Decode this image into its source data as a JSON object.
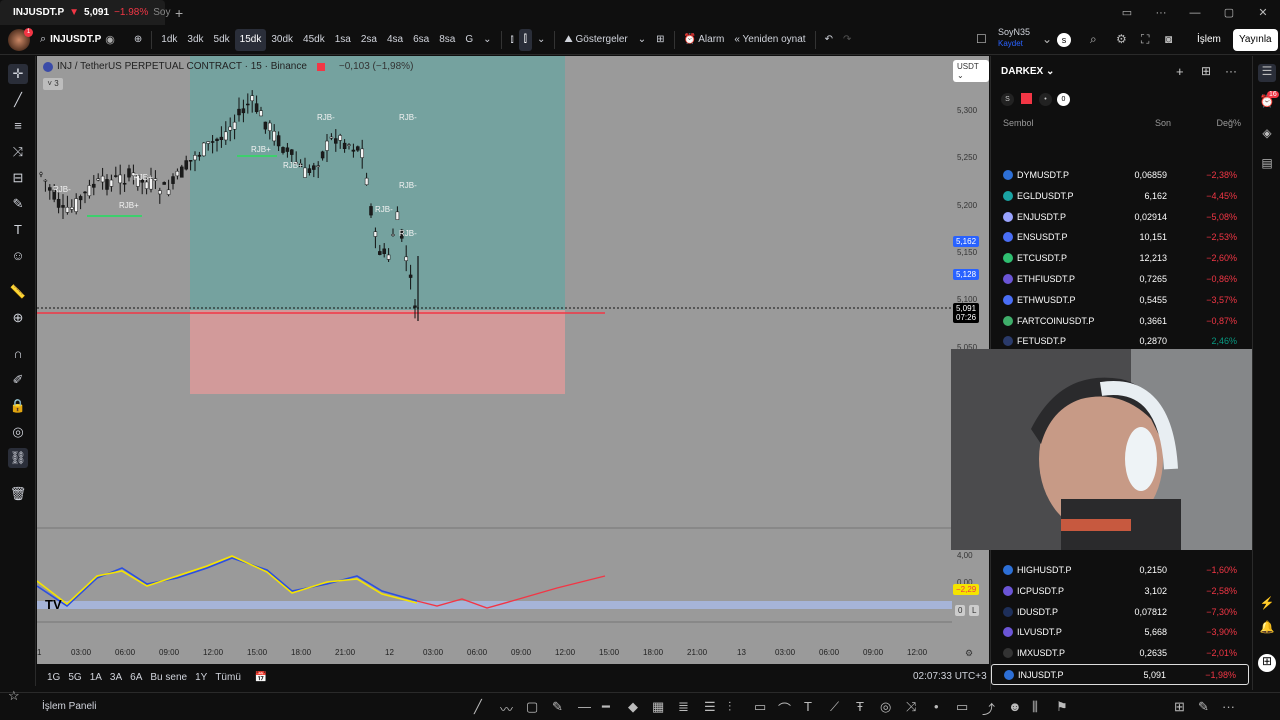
{
  "tab": {
    "symbol": "INJUSDT.P",
    "arrow": "▼",
    "price": "5,091",
    "change": "−1.98%",
    "rest": "Soy"
  },
  "toolbar": {
    "symbol": "INJUSDT.P",
    "intervals": [
      "1dk",
      "3dk",
      "5dk",
      "15dk",
      "30dk",
      "45dk",
      "1sa",
      "2sa",
      "4sa",
      "6sa",
      "8sa",
      "G"
    ],
    "active_interval": "15dk",
    "indicators_label": "Göstergeler",
    "alarm_label": "Alarm",
    "replay_label": "Yeniden oynat",
    "user_name": "SoyN35",
    "user_saved": "Kaydet",
    "trade_label": "İşlem",
    "publish_label": "Yayınla"
  },
  "chart": {
    "legend": "INJ / TetherUS PERPETUAL CONTRACT · 15 · Binance",
    "legend_change": "−0,103 (−1,98%)",
    "collapse_label": "3",
    "currency": "USDT",
    "price_ticks": [
      "5,300",
      "5,250",
      "5,200",
      "5,150",
      "5,100",
      "5,050"
    ],
    "tag_a": "5,162",
    "tag_b": "5,128",
    "last_price": "5,091",
    "countdown": "07:26",
    "labels": [
      "RJB-",
      "RJB+",
      "RJB+",
      "RJB-",
      "RJB+",
      "RJB-",
      "RJB-",
      "RJB-",
      "RJB+",
      "RJB-"
    ],
    "indicator_ticks": [
      "4,00",
      "0,00"
    ],
    "indicator_value": "−2,29",
    "indicator_flags": [
      "0",
      "L"
    ],
    "time_ticks": [
      "1",
      "03:00",
      "06:00",
      "09:00",
      "12:00",
      "15:00",
      "18:00",
      "21:00",
      "12",
      "03:00",
      "06:00",
      "09:00",
      "12:00",
      "15:00",
      "18:00",
      "21:00",
      "13",
      "03:00",
      "06:00",
      "09:00",
      "12:00"
    ]
  },
  "periods": [
    "1G",
    "5G",
    "1A",
    "3A",
    "6A",
    "Bu sene",
    "1Y",
    "Tümü"
  ],
  "clock": "02:07:33 UTC+3",
  "bottombar": {
    "panel_label": "İşlem Paneli"
  },
  "watchlist": {
    "title": "DARKEX",
    "badge_count": "0",
    "col_symbol": "Sembol",
    "col_last": "Son",
    "col_change": "Değ%",
    "rows": [
      {
        "symbol": "DYMUSDT.P",
        "last": "0,06859",
        "change": "−2,38%",
        "dir": "neg",
        "icon": "#2d6fd6"
      },
      {
        "symbol": "EGLDUSDT.P",
        "last": "6,162",
        "change": "−4,45%",
        "dir": "neg",
        "icon": "#1aa3a3"
      },
      {
        "symbol": "ENJUSDT.P",
        "last": "0,02914",
        "change": "−5,08%",
        "dir": "neg",
        "icon": "#9aa4ff"
      },
      {
        "symbol": "ENSUSDT.P",
        "last": "10,151",
        "change": "−2,53%",
        "dir": "neg",
        "icon": "#4a6ef5"
      },
      {
        "symbol": "ETCUSDT.P",
        "last": "12,213",
        "change": "−2,60%",
        "dir": "neg",
        "icon": "#2fbf71"
      },
      {
        "symbol": "ETHFIUSDT.P",
        "last": "0,7265",
        "change": "−0,86%",
        "dir": "neg",
        "icon": "#6b55d6"
      },
      {
        "symbol": "ETHWUSDT.P",
        "last": "0,5455",
        "change": "−3,57%",
        "dir": "neg",
        "icon": "#4a6ef5"
      },
      {
        "symbol": "FARTCOINUSDT.P",
        "last": "0,3661",
        "change": "−0,87%",
        "dir": "neg",
        "icon": "#3fae6a"
      },
      {
        "symbol": "FETUSDT.P",
        "last": "0,2870",
        "change": "2,46%",
        "dir": "pos",
        "icon": "#2a3a6a"
      }
    ],
    "rows_bottom": [
      {
        "symbol": "HIGHUSDT.P",
        "last": "0,2150",
        "change": "−1,60%",
        "dir": "neg",
        "icon": "#2d6fd6"
      },
      {
        "symbol": "ICPUSDT.P",
        "last": "3,102",
        "change": "−2,58%",
        "dir": "neg",
        "icon": "#6b55d6"
      },
      {
        "symbol": "IDUSDT.P",
        "last": "0,07812",
        "change": "−7,30%",
        "dir": "neg",
        "icon": "#1e2f5a"
      },
      {
        "symbol": "ILVUSDT.P",
        "last": "5,668",
        "change": "−3,90%",
        "dir": "neg",
        "icon": "#6b55d6"
      },
      {
        "symbol": "IMXUSDT.P",
        "last": "0,2635",
        "change": "−2,01%",
        "dir": "neg",
        "icon": "#333"
      },
      {
        "symbol": "INJUSDT.P",
        "last": "5,091",
        "change": "−1,98%",
        "dir": "neg",
        "icon": "#2d6fd6"
      }
    ],
    "right_badge": "16"
  },
  "colors": {
    "accent": "#2962ff",
    "negative": "#f23645",
    "positive": "#089981",
    "chart_bg": "#9a9a9a"
  }
}
